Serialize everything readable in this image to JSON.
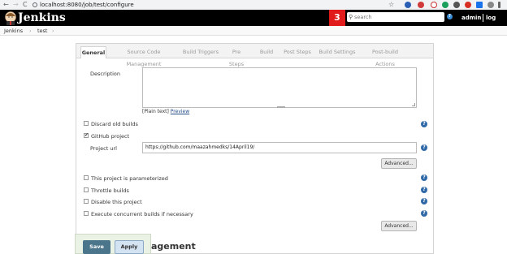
{
  "browser": {
    "back": "←",
    "forward": "→",
    "reload": "C",
    "url": "localhost:8080/job/test/configure"
  },
  "header": {
    "title": "Jenkins",
    "notifications": "3",
    "search_placeholder": "search",
    "user": "admin",
    "logout": "log out",
    "help": "?"
  },
  "breadcrumb": {
    "items": [
      "Jenkins",
      "›",
      "test",
      "›"
    ]
  },
  "tabs": [
    "General",
    "Source Code Management",
    "Build Triggers",
    "Pre Steps",
    "Build",
    "Post Steps",
    "Build Settings",
    "Post-build Actions"
  ],
  "general": {
    "description_label": "Description",
    "plain_text": "[Plain text]",
    "preview": "Preview",
    "discard_old_builds": "Discard old builds",
    "github_project": "GitHub project",
    "project_url_label": "Project url",
    "project_url_value": "https://github.com/maazahmedks/14April19/",
    "advanced": "Advanced...",
    "parameterized": "This project is parameterized",
    "throttle": "Throttle builds",
    "disable": "Disable this project",
    "concurrent": "Execute concurrent builds if necessary",
    "advanced2": "Advanced..."
  },
  "section_partial_title": "agement",
  "actions": {
    "save": "Save",
    "apply": "Apply"
  },
  "colors": {
    "header_bg": "#000000",
    "badge": "#e11b1b",
    "save": "#4b758b",
    "help": "#3069a8"
  }
}
